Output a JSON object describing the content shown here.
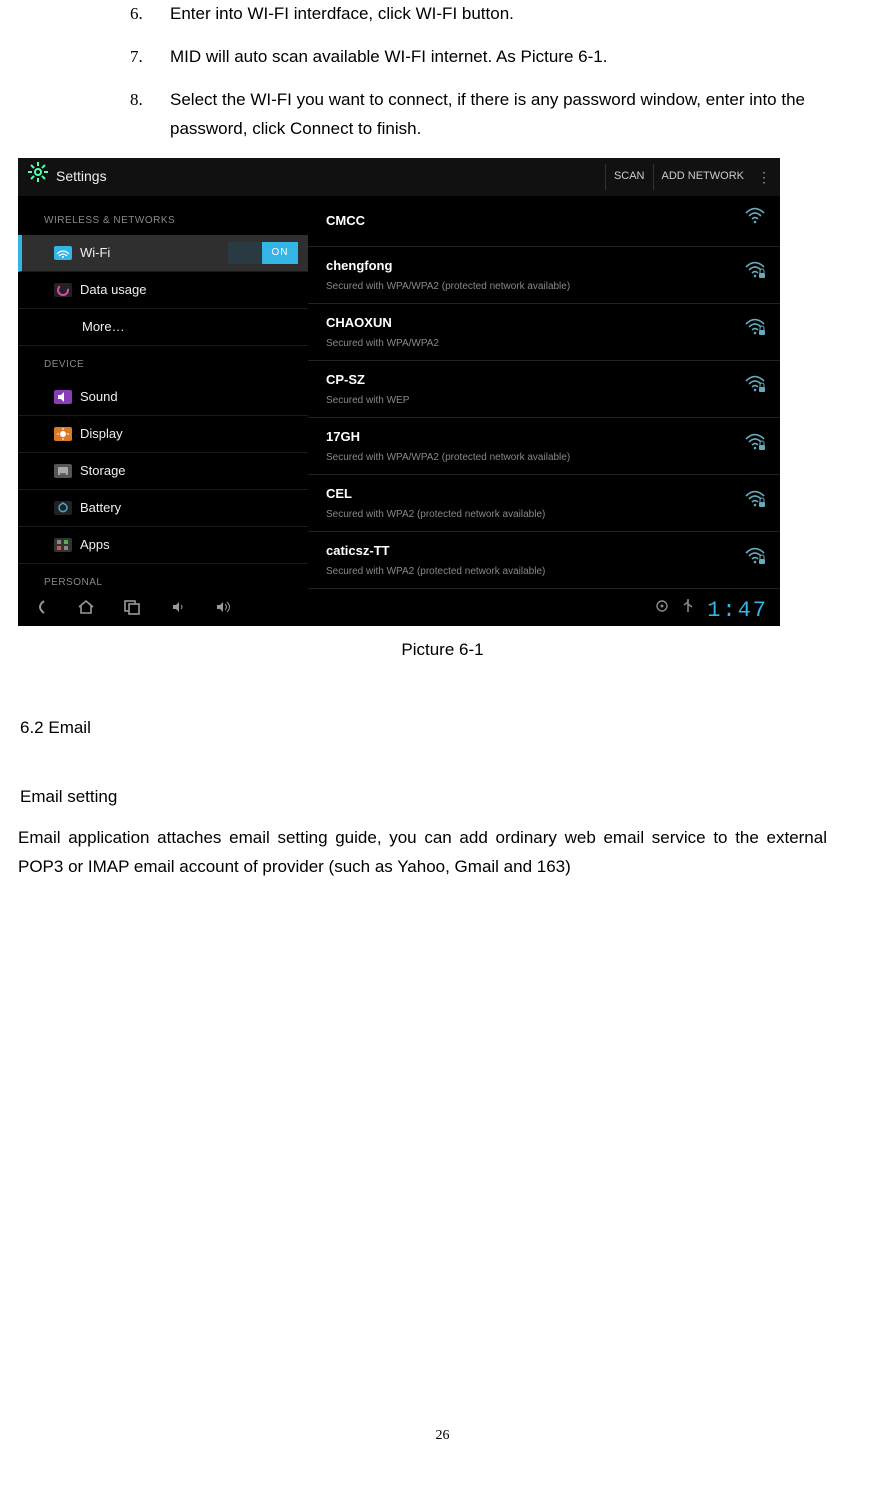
{
  "list": {
    "item6": {
      "num": "6.",
      "text": "Enter into WI-FI interdface, click WI-FI button."
    },
    "item7": {
      "num": "7.",
      "text": "MID will auto scan available WI-FI internet. As Picture 6-1."
    },
    "item8": {
      "num": "8.",
      "text": "Select the WI-FI you want to connect, if there is any password window, enter into the password, click Connect to finish."
    }
  },
  "screenshot": {
    "title": "Settings",
    "scan": "SCAN",
    "add_network": "ADD NETWORK",
    "section_wireless": "WIRELESS & NETWORKS",
    "section_device": "DEVICE",
    "section_personal": "PERSONAL",
    "sidebar": {
      "wifi": "Wi-Fi",
      "switch_on": "ON",
      "data_usage": "Data usage",
      "more": "More…",
      "sound": "Sound",
      "display": "Display",
      "storage": "Storage",
      "battery": "Battery",
      "apps": "Apps"
    },
    "networks": [
      {
        "name": "CMCC",
        "sub": "",
        "locked": false
      },
      {
        "name": "chengfong",
        "sub": "Secured with WPA/WPA2 (protected network available)",
        "locked": true
      },
      {
        "name": "CHAOXUN",
        "sub": "Secured with WPA/WPA2",
        "locked": true
      },
      {
        "name": "CP-SZ",
        "sub": "Secured with WEP",
        "locked": true
      },
      {
        "name": "17GH",
        "sub": "Secured with WPA/WPA2 (protected network available)",
        "locked": true
      },
      {
        "name": "CEL",
        "sub": "Secured with WPA2 (protected network available)",
        "locked": true
      },
      {
        "name": "caticsz-TT",
        "sub": "Secured with WPA2 (protected network available)",
        "locked": true
      }
    ],
    "clock": "1:47"
  },
  "caption": "Picture 6-1",
  "section_email": "6.2 Email",
  "email_setting_h": "Email setting",
  "email_para": "Email application attaches email setting guide, you can add ordinary web email service to the external POP3 or IMAP email account of provider (such as Yahoo, Gmail and 163)",
  "page_number": "26"
}
